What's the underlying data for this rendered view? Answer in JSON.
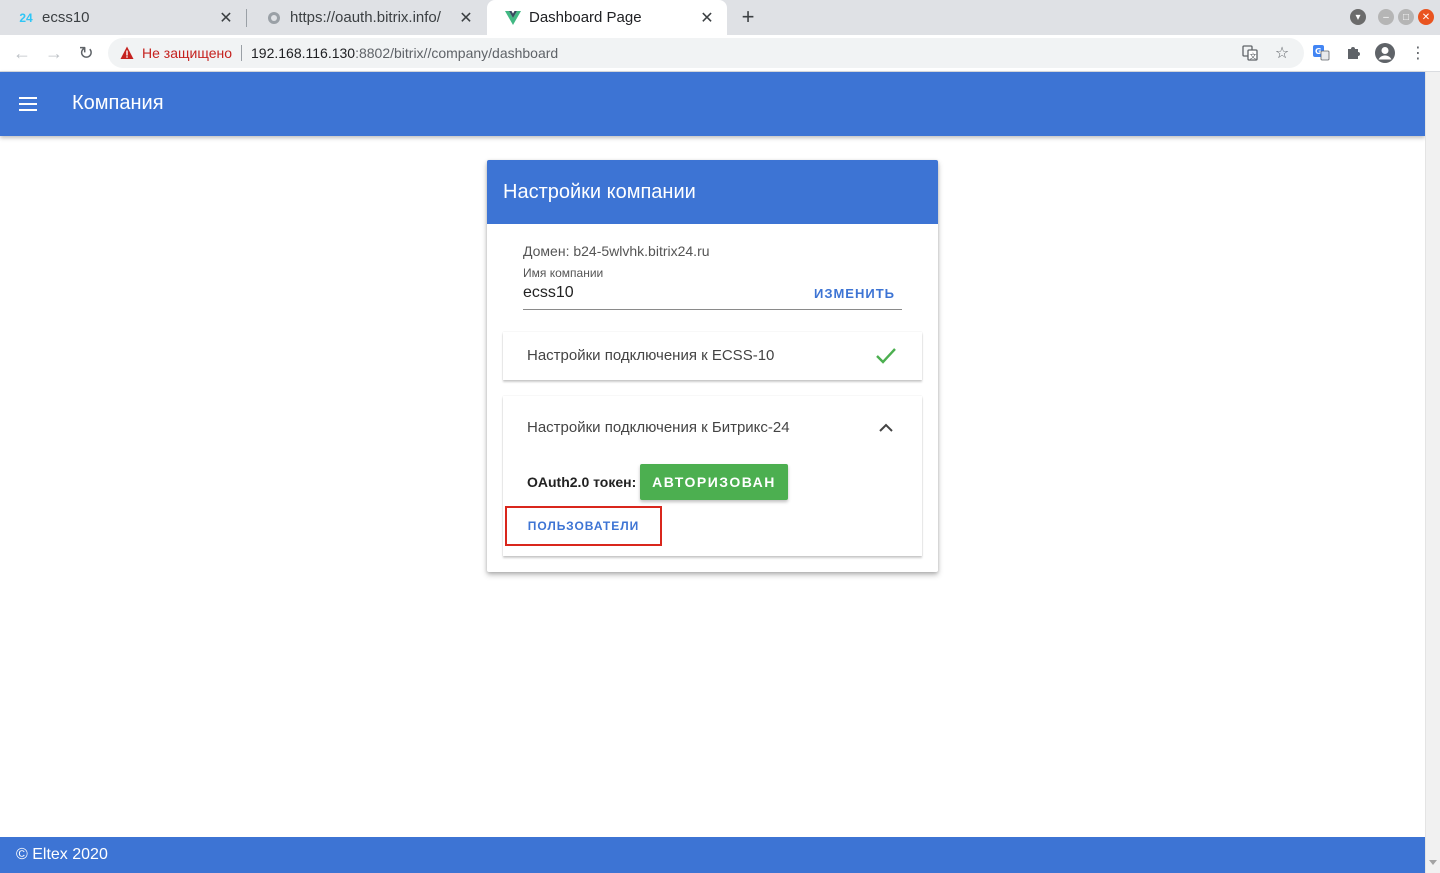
{
  "browser": {
    "tabs": [
      {
        "title": "ecss10",
        "favicon": "24",
        "active": false
      },
      {
        "title": "https://oauth.bitrix.info/",
        "favicon": "globe-icon",
        "active": false
      },
      {
        "title": "Dashboard Page",
        "favicon": "vue-icon",
        "active": true
      }
    ],
    "security_label": "Не защищено",
    "url_host": "192.168.116.130",
    "url_path": ":8802/bitrix//company/dashboard"
  },
  "app": {
    "title": "Компания",
    "accent_color": "#3d74d4"
  },
  "card": {
    "title": "Настройки компании",
    "domain": "Домен: b24-5wlvhk.bitrix24.ru",
    "company_name_label": "Имя компании",
    "company_name_value": "ecss10",
    "change_label": "ИЗМЕНИТЬ",
    "panels": [
      {
        "title": "Настройки подключения к ECSS-10",
        "status_icon": "check-icon"
      },
      {
        "title": "Настройки подключения к Битрикс-24",
        "status_icon": "chevron-up-icon",
        "expanded": true
      }
    ],
    "oauth_label": "OAuth2.0 токен:",
    "authorized_label": "АВТОРИЗОВАН",
    "users_label": "ПОЛЬЗОВАТЕЛИ",
    "success_color": "#4caf50"
  },
  "footer": {
    "text": "© Eltex 2020"
  }
}
